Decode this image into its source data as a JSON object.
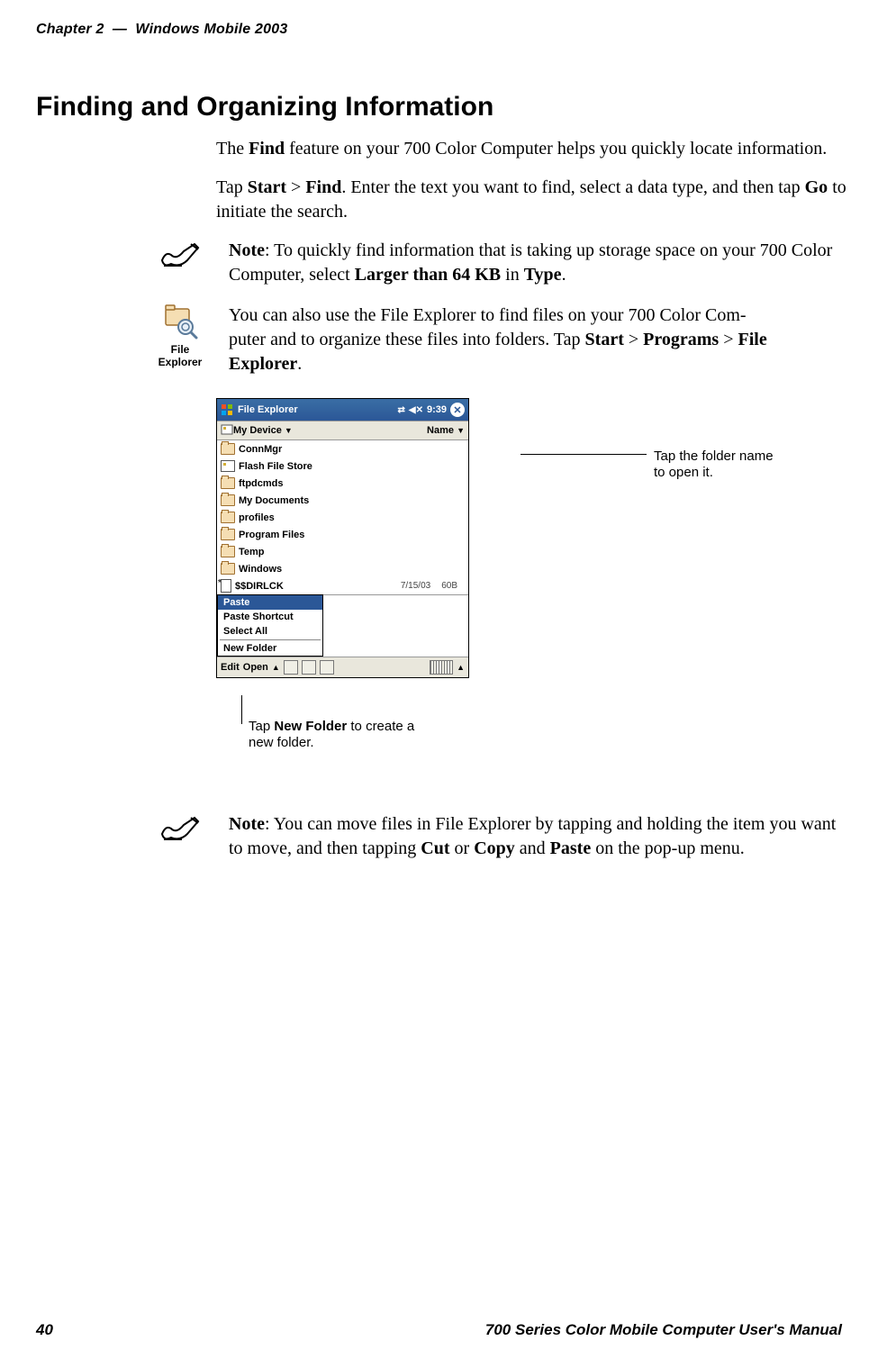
{
  "header": {
    "chapter": "Chapter 2",
    "sep": "—",
    "book_section": "Windows Mobile 2003"
  },
  "heading": "Finding and Organizing Information",
  "p1_before_find": "The ",
  "p1_find": "Find",
  "p1_after_find": " feature on your 700 Color Computer helps you quickly locate information.",
  "p2_a": "Tap ",
  "p2_start": "Start",
  "p2_gt1": " > ",
  "p2_find": "Find",
  "p2_b": ". Enter the text you want to find, select a data type, and then tap ",
  "p2_go": "Go",
  "p2_c": " to initiate the search.",
  "note1_label": "Note",
  "note1_a": ": To quickly find information that is taking up storage space on your 700 Color Computer, select ",
  "note1_bold": "Larger than 64 KB",
  "note1_b": " in ",
  "note1_type": "Type",
  "note1_c": ".",
  "fe_icon_label": "File Explorer",
  "p3_a": "You can also use the File Explorer to find files on your 700 Color Com",
  "p3_puter": "puter and to organize these files into folders. Tap ",
  "p3_start": "Start",
  "p3_gt1": " > ",
  "p3_programs": "Programs",
  "p3_gt2": " > ",
  "p3_fe": "File Explorer",
  "p3_end": ".",
  "screenshot": {
    "title": "File Explorer",
    "time": "9:39",
    "nav_left": "My Device",
    "nav_right": "Name",
    "items": [
      {
        "type": "folder",
        "name": "ConnMgr",
        "date": "",
        "size": ""
      },
      {
        "type": "card",
        "name": "Flash File Store",
        "date": "",
        "size": ""
      },
      {
        "type": "folder",
        "name": "ftpdcmds",
        "date": "",
        "size": ""
      },
      {
        "type": "folder",
        "name": "My Documents",
        "date": "",
        "size": ""
      },
      {
        "type": "folder",
        "name": "profiles",
        "date": "",
        "size": ""
      },
      {
        "type": "folder",
        "name": "Program Files",
        "date": "",
        "size": ""
      },
      {
        "type": "folder",
        "name": "Temp",
        "date": "",
        "size": ""
      },
      {
        "type": "folder",
        "name": "Windows",
        "date": "",
        "size": ""
      },
      {
        "type": "file",
        "name": "$$DIRLCK",
        "date": "7/15/03",
        "size": "60B"
      }
    ],
    "menu": {
      "sel": "Paste",
      "items": [
        "Paste",
        "Paste Shortcut",
        "Select All",
        "New Folder"
      ]
    },
    "bottom_left": "Edit",
    "bottom_open": "Open"
  },
  "annot_right_line1": "Tap the folder name",
  "annot_right_line2": "to open it.",
  "annot_below_a": "Tap ",
  "annot_below_bold": "New Folder",
  "annot_below_b": " to create a new folder.",
  "note2_label": "Note",
  "note2_a": ": You can move files in File Explorer by tapping and holding the item you want to move, and then tapping ",
  "note2_cut": "Cut",
  "note2_or": " or ",
  "note2_copy": "Copy",
  "note2_and": " and ",
  "note2_paste": "Paste",
  "note2_b": " on the pop-up menu.",
  "footer": {
    "page": "40",
    "title": "700 Series Color Mobile Computer User's Manual"
  }
}
